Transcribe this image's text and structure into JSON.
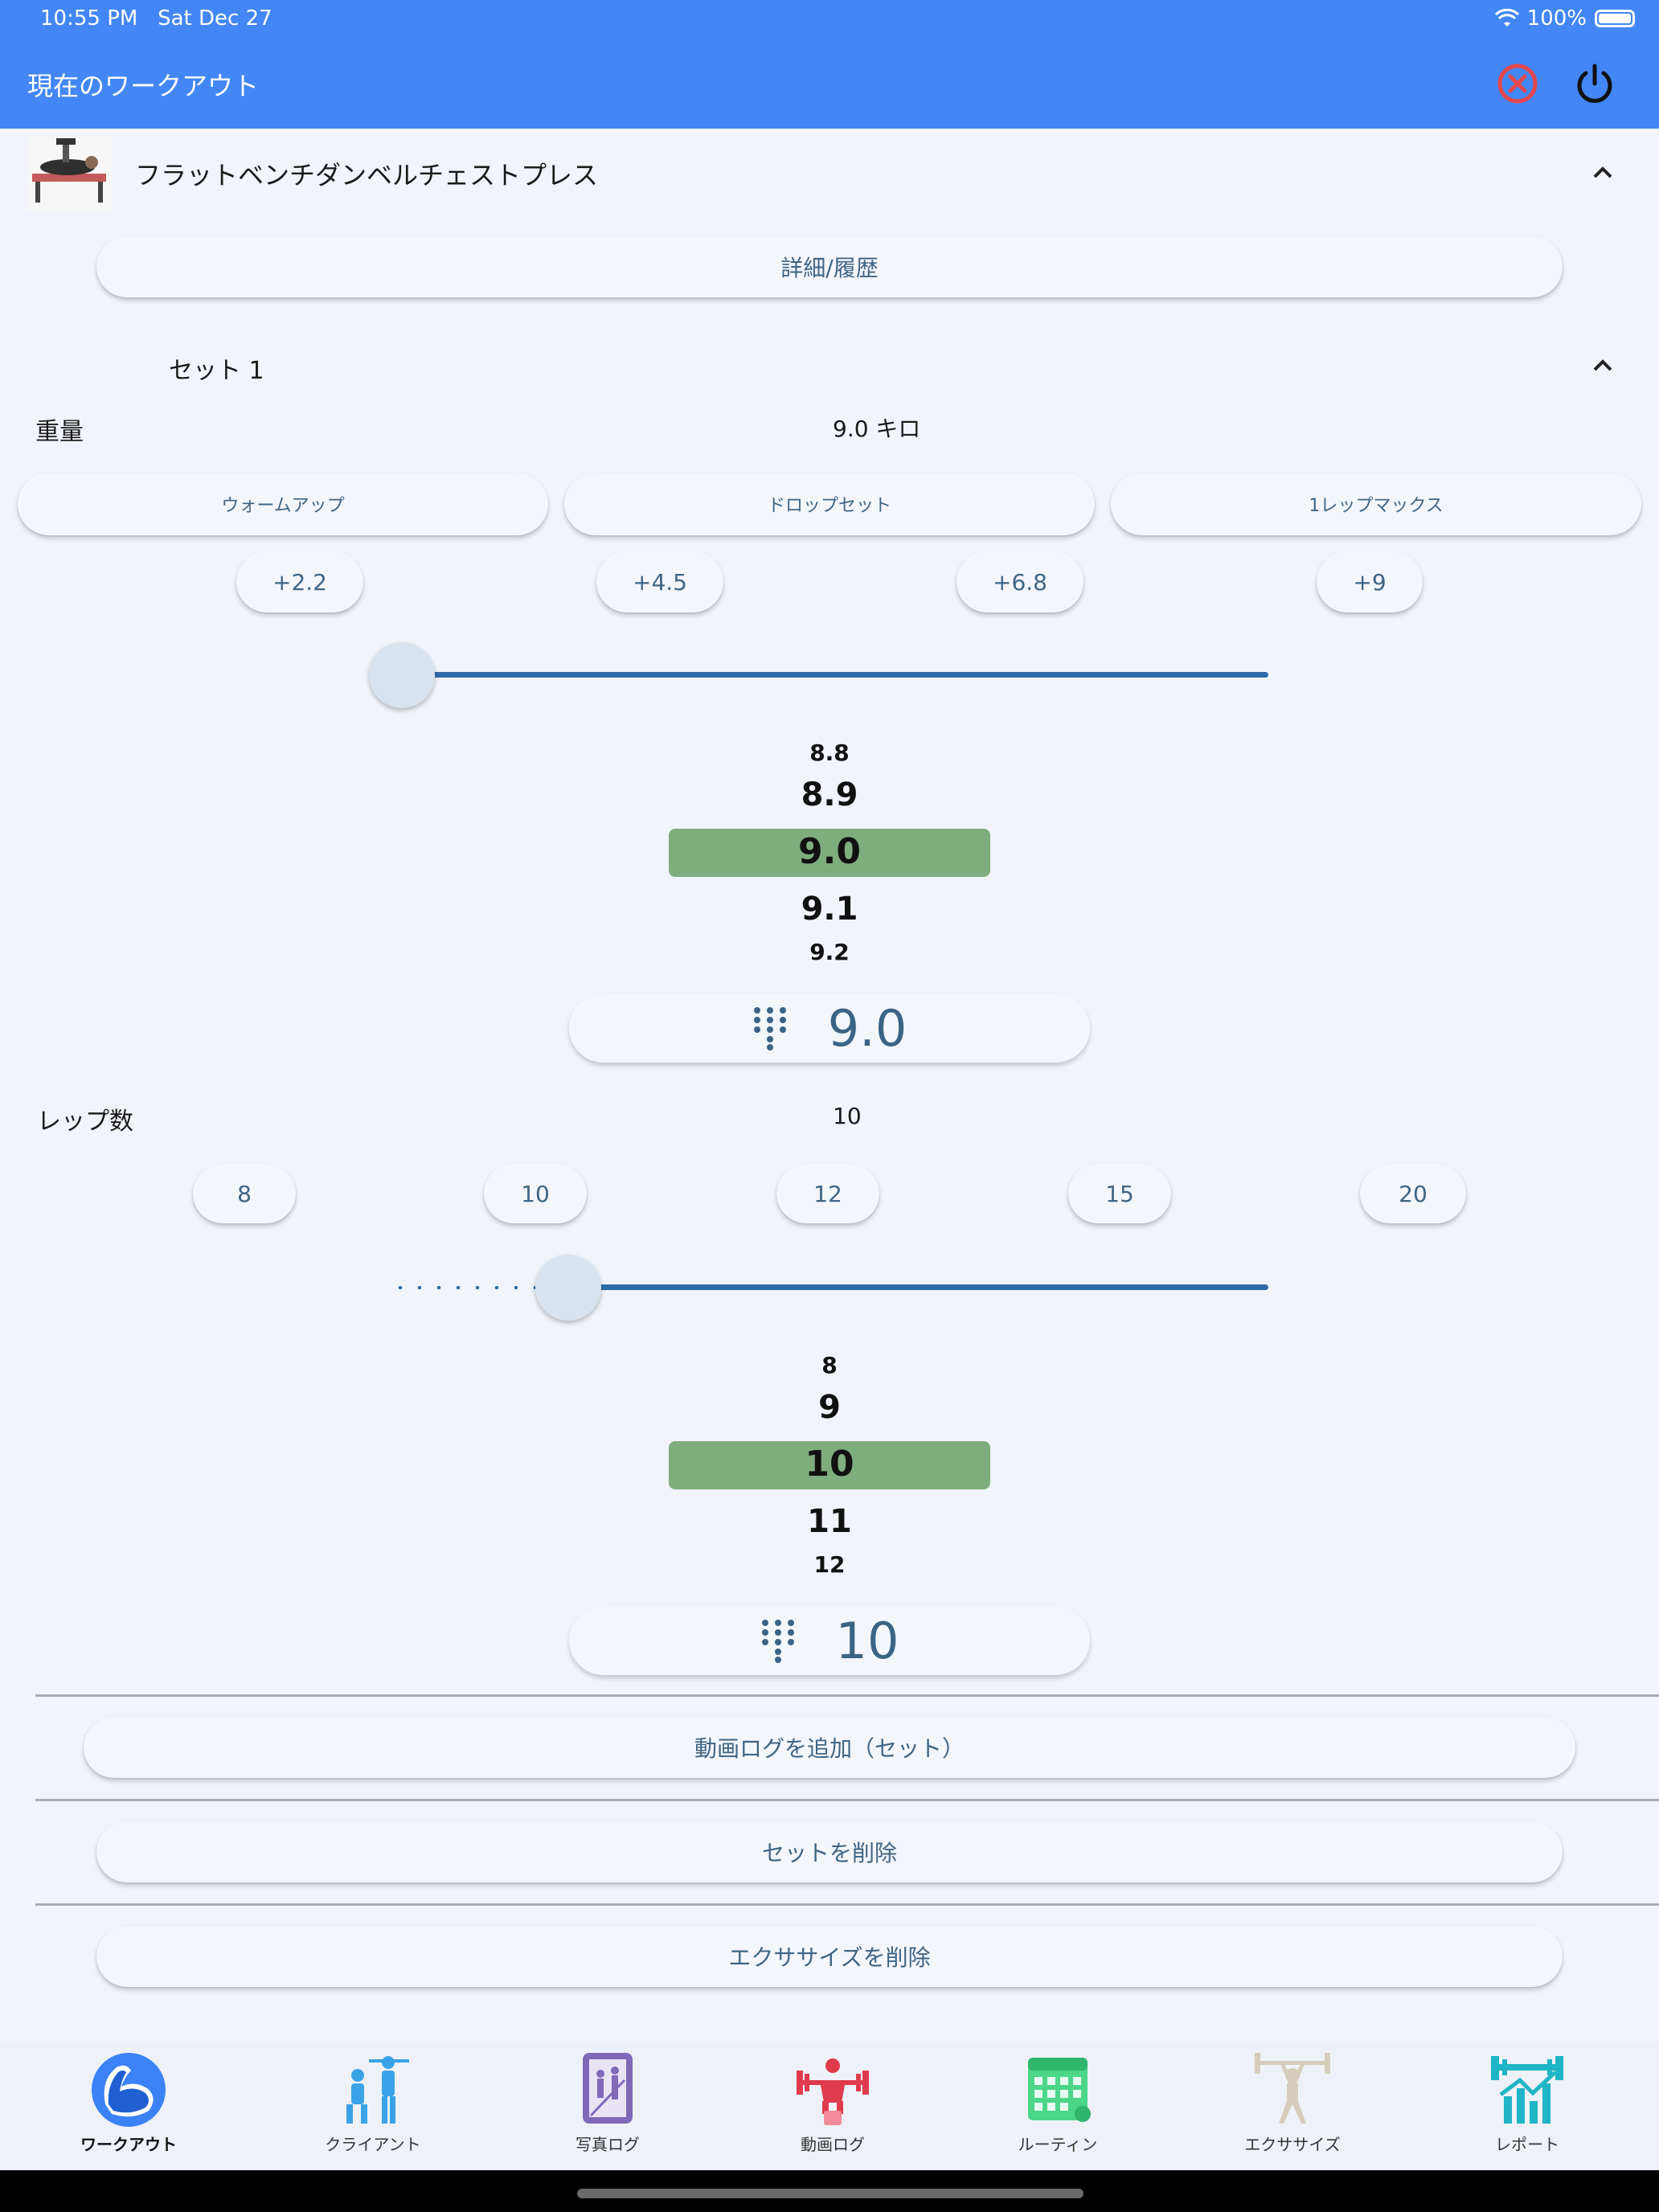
{
  "status_bar": {
    "time": "10:55 PM",
    "date": "Sat Dec 27",
    "battery": "100%"
  },
  "app_bar": {
    "title": "現在のワークアウト"
  },
  "exercise": {
    "name": "フラットベンチダンベルチェストプレス",
    "details_button": "詳細/履歴"
  },
  "set": {
    "title": "セット 1",
    "weight_label": "重量",
    "weight_value": "9.0 キロ",
    "set_types": [
      "ウォームアップ",
      "ドロップセット",
      "1レップマックス"
    ],
    "weight_increments": [
      "+2.2",
      "+4.5",
      "+6.8",
      "+9"
    ],
    "weight_slider": 0,
    "weight_picker": [
      "8.8",
      "8.9",
      "9.0",
      "9.1",
      "9.2"
    ],
    "weight_input": "9.0",
    "reps_label": "レップ数",
    "reps_value": "10",
    "reps_presets": [
      "8",
      "10",
      "12",
      "15",
      "20"
    ],
    "reps_slider": 0.2,
    "reps_picker": [
      "8",
      "9",
      "10",
      "11",
      "12"
    ],
    "reps_input": "10",
    "add_video_button": "動画ログを追加（セット）",
    "delete_set_button": "セットを削除",
    "delete_exercise_button": "エクササイズを削除"
  },
  "bottom_nav": {
    "items": [
      {
        "label": "ワークアウト",
        "icon": "flexed-arm-icon",
        "color": "#3b82f6"
      },
      {
        "label": "クライアント",
        "icon": "trainer-client-icon",
        "color": "#3aa3e8"
      },
      {
        "label": "写真ログ",
        "icon": "photo-log-icon",
        "color": "#7f69b8"
      },
      {
        "label": "動画ログ",
        "icon": "weightlifter-video-icon",
        "color": "#e03a4d"
      },
      {
        "label": "ルーティン",
        "icon": "calendar-routine-icon",
        "color": "#4bd68a"
      },
      {
        "label": "エクササイズ",
        "icon": "barbell-person-icon",
        "color": "#d5cdbb"
      },
      {
        "label": "レポート",
        "icon": "chart-dumbbell-icon",
        "color": "#1fb5c6"
      }
    ]
  },
  "colors": {
    "app_bar": "#4287f5",
    "selected_picker": "#7fae7e",
    "slider": "#2e6aa8",
    "close_icon": "#e5484d"
  }
}
